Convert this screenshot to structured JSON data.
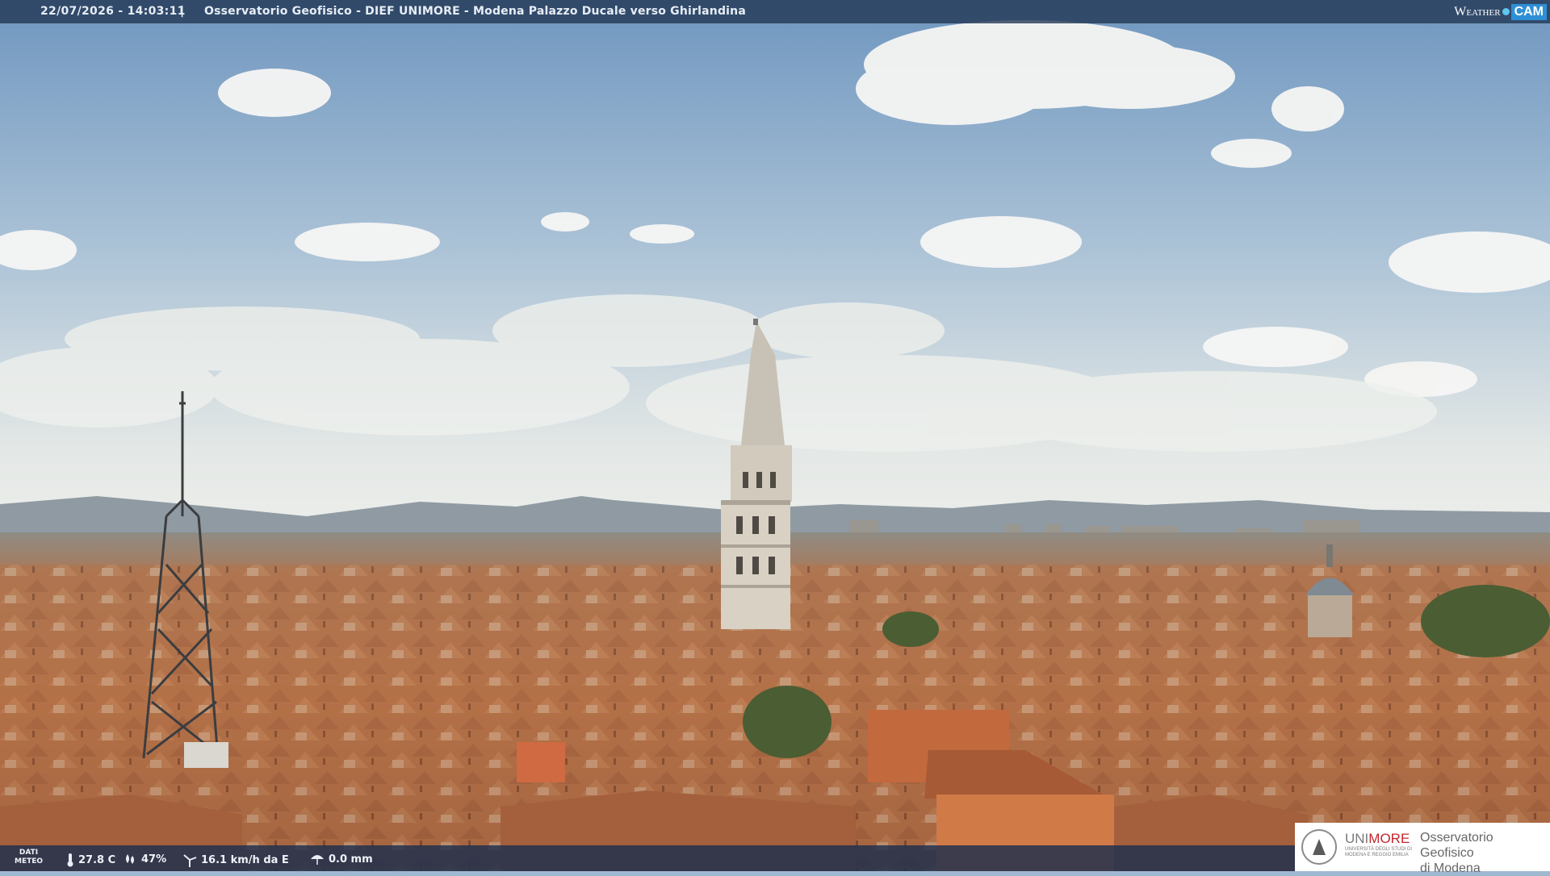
{
  "overlay": {
    "timestamp": "22/07/2026 - 14:03:11",
    "separator": "|",
    "location": "Osservatorio Geofisico - DIEF UNIMORE - Modena Palazzo Ducale verso Ghirlandina",
    "brand_weather": "Weather",
    "brand_cam": "CAM"
  },
  "weather": {
    "label_line1": "DATI",
    "label_line2": "METEO",
    "temperature": "27.8 C",
    "humidity": "47%",
    "wind": "16.1 km/h da E",
    "rain": "0.0 mm"
  },
  "logo": {
    "name_plain": "UNI",
    "name_accent": "MORE",
    "university_line1": "UNIVERSITÀ DEGLI STUDI DI",
    "university_line2": "MODENA E REGGIO EMILIA",
    "observatory_line1": "Osservatorio Geofisico",
    "observatory_line2": "di Modena"
  },
  "colors": {
    "sky_top": "#6f96bf",
    "sky_horizon": "#e8ecec",
    "roofs": "#b9754a",
    "overlay_bar": "#203452",
    "unimore_red": "#c1272d"
  }
}
